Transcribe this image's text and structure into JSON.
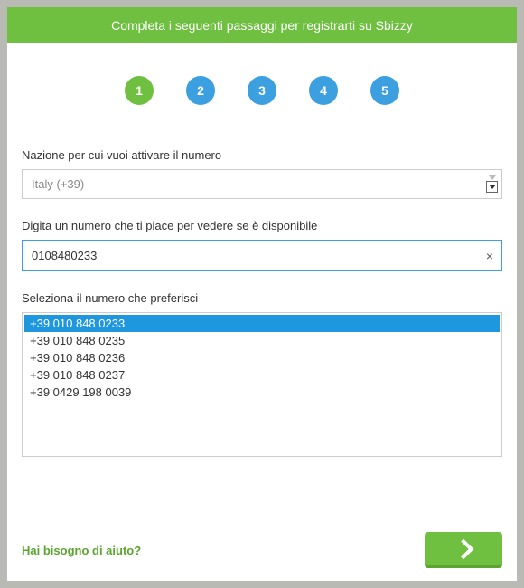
{
  "header": {
    "title": "Completa i seguenti passaggi per registrarti su Sbizzy"
  },
  "steps": {
    "items": [
      {
        "n": "1",
        "active": true
      },
      {
        "n": "2",
        "active": false
      },
      {
        "n": "3",
        "active": false
      },
      {
        "n": "4",
        "active": false
      },
      {
        "n": "5",
        "active": false
      }
    ]
  },
  "nation": {
    "label": "Nazione per cui vuoi attivare il numero",
    "value": "Italy (+39)"
  },
  "number_input": {
    "label": "Digita un numero che ti piace per vedere se è disponibile",
    "value": "0108480233"
  },
  "number_list": {
    "label": "Seleziona il numero che preferisci",
    "items": [
      {
        "text": "+39 010 848 0233",
        "selected": true
      },
      {
        "text": "+39 010 848 0235",
        "selected": false
      },
      {
        "text": "+39 010 848 0236",
        "selected": false
      },
      {
        "text": "+39 010 848 0237",
        "selected": false
      },
      {
        "text": "+39 0429 198 0039",
        "selected": false
      }
    ]
  },
  "footer": {
    "help": "Hai bisogno di aiuto?"
  }
}
